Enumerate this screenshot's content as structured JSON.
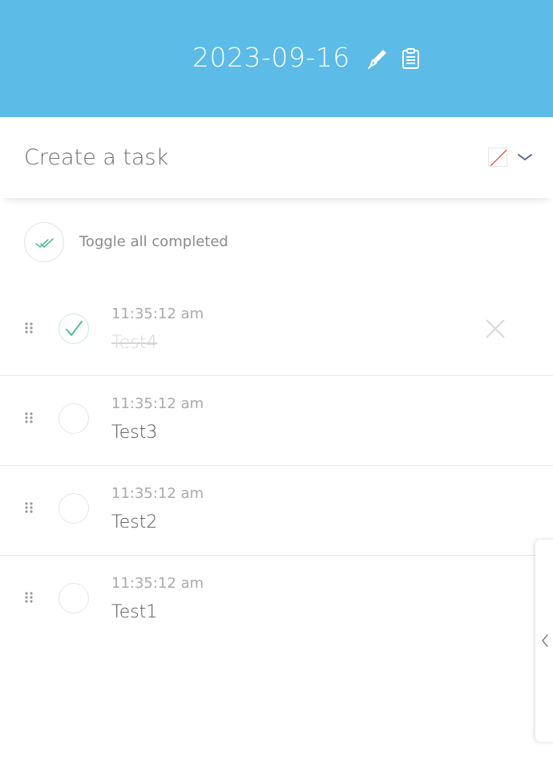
{
  "header": {
    "date": "2023-09-16",
    "background_color": "#5cbbe7",
    "edit_icon": "pencil-icon",
    "copy_icon": "clipboard-icon"
  },
  "create": {
    "placeholder": "Create a task",
    "color_swatch": "none",
    "dropdown_icon": "chevron-down-icon"
  },
  "toggle_all": {
    "label": "Toggle all completed",
    "icon": "double-check-icon"
  },
  "tasks": [
    {
      "time": "11:35:12 am",
      "title": "Test4",
      "completed": true
    },
    {
      "time": "11:35:12 am",
      "title": "Test3",
      "completed": false
    },
    {
      "time": "11:35:12 am",
      "title": "Test2",
      "completed": false
    },
    {
      "time": "11:35:12 am",
      "title": "Test1",
      "completed": false
    }
  ],
  "side_panel": {
    "icon": "chevron-left-icon"
  },
  "colors": {
    "accent": "#5cbbe7",
    "check_green": "#4fbf9f"
  }
}
